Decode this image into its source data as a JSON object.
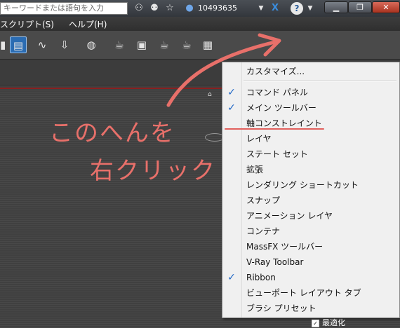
{
  "titlebar": {
    "search_placeholder": "キーワードまたは語句を入力",
    "user_id": "10493635",
    "help_label": "?"
  },
  "menubar": {
    "items": [
      "スクリプト(S)",
      "ヘルプ(H)"
    ]
  },
  "annotation": {
    "line1": "このへんを",
    "line2": "右クリック"
  },
  "context_menu": {
    "customize": "カスタマイズ...",
    "items": [
      {
        "label": "コマンド パネル",
        "checked": true
      },
      {
        "label": "メイン ツールバー",
        "checked": true
      },
      {
        "label": "軸コンストレイント",
        "checked": false
      },
      {
        "label": "レイヤ",
        "checked": false
      },
      {
        "label": "ステート セット",
        "checked": false
      },
      {
        "label": "拡張",
        "checked": false
      },
      {
        "label": "レンダリング ショートカット",
        "checked": false
      },
      {
        "label": "スナップ",
        "checked": false
      },
      {
        "label": "アニメーション レイヤ",
        "checked": false
      },
      {
        "label": "コンテナ",
        "checked": false
      },
      {
        "label": "MassFX ツールバー",
        "checked": false
      },
      {
        "label": "V-Ray Toolbar",
        "checked": false
      },
      {
        "label": "Ribbon",
        "checked": true
      },
      {
        "label": "ビューポート レイアウト タブ",
        "checked": false
      },
      {
        "label": "ブラシ プリセット",
        "checked": false
      }
    ],
    "check_glyph": "✓"
  },
  "bottom": {
    "optimize_label": "最適化"
  },
  "colors": {
    "annotation": "#e8706a",
    "check": "#1e66c6",
    "active_tool": "#2a6cb3"
  }
}
